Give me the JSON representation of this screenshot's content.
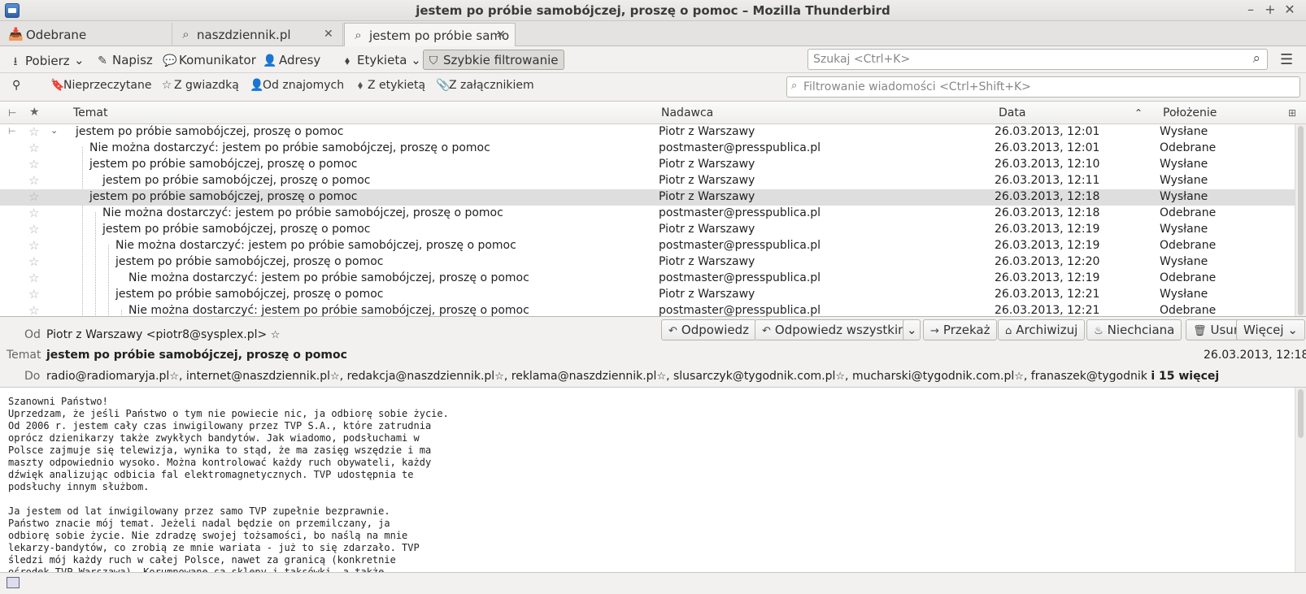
{
  "window": {
    "title": "jestem po próbie samobójczej, proszę o pomoc – Mozilla Thunderbird"
  },
  "tabs": [
    {
      "label": "Odebrane"
    },
    {
      "label": "naszdziennik.pl"
    },
    {
      "label": "jestem po próbie samo"
    }
  ],
  "toolbar": {
    "get_label": "Pobierz",
    "write_label": "Napisz",
    "chat_label": "Komunikator",
    "address_label": "Adresy",
    "tag_label": "Etykieta",
    "quickfilter_label": "Szybkie filtrowanie",
    "search_placeholder": "Szukaj <Ctrl+K>"
  },
  "quickfilter": {
    "unread": "Nieprzeczytane",
    "starred": "Z gwiazdką",
    "contacts": "Od znajomych",
    "tagged": "Z etykietą",
    "attachments": "Z załącznikiem",
    "filter_placeholder": "Filtrowanie wiadomości <Ctrl+Shift+K>"
  },
  "columns": {
    "subject": "Temat",
    "from": "Nadawca",
    "date": "Data",
    "location": "Położenie"
  },
  "messages": [
    {
      "subject": "jestem po próbie samobójczej, proszę o pomoc",
      "from": "Piotr z Warszawy",
      "date": "26.03.2013, 12:01",
      "location": "Wysłane"
    },
    {
      "subject": "Nie można dostarczyć: jestem po próbie samobójczej, proszę o pomoc",
      "from": "postmaster@presspublica.pl",
      "date": "26.03.2013, 12:01",
      "location": "Odebrane"
    },
    {
      "subject": "jestem po próbie samobójczej, proszę o pomoc",
      "from": "Piotr z Warszawy",
      "date": "26.03.2013, 12:10",
      "location": "Wysłane"
    },
    {
      "subject": "jestem po próbie samobójczej, proszę o pomoc",
      "from": "Piotr z Warszawy",
      "date": "26.03.2013, 12:11",
      "location": "Wysłane"
    },
    {
      "subject": "jestem po próbie samobójczej, proszę o pomoc",
      "from": "Piotr z Warszawy",
      "date": "26.03.2013, 12:18",
      "location": "Wysłane"
    },
    {
      "subject": "Nie można dostarczyć: jestem po próbie samobójczej, proszę o pomoc",
      "from": "postmaster@presspublica.pl",
      "date": "26.03.2013, 12:18",
      "location": "Odebrane"
    },
    {
      "subject": "jestem po próbie samobójczej, proszę o pomoc",
      "from": "Piotr z Warszawy",
      "date": "26.03.2013, 12:19",
      "location": "Wysłane"
    },
    {
      "subject": "Nie można dostarczyć: jestem po próbie samobójczej, proszę o pomoc",
      "from": "postmaster@presspublica.pl",
      "date": "26.03.2013, 12:19",
      "location": "Odebrane"
    },
    {
      "subject": "jestem po próbie samobójczej, proszę o pomoc",
      "from": "Piotr z Warszawy",
      "date": "26.03.2013, 12:20",
      "location": "Wysłane"
    },
    {
      "subject": "Nie można dostarczyć: jestem po próbie samobójczej, proszę o pomoc",
      "from": "postmaster@presspublica.pl",
      "date": "26.03.2013, 12:19",
      "location": "Odebrane"
    },
    {
      "subject": "jestem po próbie samobójczej, proszę o pomoc",
      "from": "Piotr z Warszawy",
      "date": "26.03.2013, 12:21",
      "location": "Wysłane"
    },
    {
      "subject": "Nie można dostarczyć: jestem po próbie samobójczej, proszę o pomoc",
      "from": "postmaster@presspublica.pl",
      "date": "26.03.2013, 12:21",
      "location": "Odebrane"
    }
  ],
  "header": {
    "from_label": "Od",
    "from_value": "Piotr z Warszawy <piotr8@sysplex.pl>",
    "subject_label": "Temat",
    "subject_value": "jestem po próbie samobójczej, proszę o pomoc",
    "date_value": "26.03.2013, 12:18",
    "to_label": "Do",
    "recipients": [
      "radio@radiomaryja.pl",
      "internet@naszdziennik.pl",
      "redakcja@naszdziennik.pl",
      "reklama@naszdziennik.pl",
      "slusarczyk@tygodnik.com.pl",
      "mucharski@tygodnik.com.pl",
      "franaszek@tygodnik"
    ],
    "more_recipients": "i 15 więcej",
    "buttons": {
      "reply": "Odpowiedz",
      "reply_all": "Odpowiedz wszystkim",
      "forward": "Przekaż",
      "archive": "Archiwizuj",
      "junk": "Niechciana",
      "delete": "Usuń",
      "more": "Więcej"
    }
  },
  "body": {
    "text": "Szanowni Państwo!\nUprzedzam, że jeśli Państwo o tym nie powiecie nic, ja odbiorę sobie życie.\nOd 2006 r. jestem cały czas inwigilowany przez TVP S.A., które zatrudnia\noprócz dzienikarzy także zwykłych bandytów. Jak wiadomo, podsłuchami w\nPolsce zajmuje się telewizja, wynika to stąd, że ma zasięg wszędzie i ma\nmaszty odpowiednio wysoko. Można kontrolować każdy ruch obywateli, każdy\ndźwięk analizując odbicia fal elektromagnetycznych. TVP udostępnia te\npodsłuchy innym służbom.\n\nJa jestem od lat inwigilowany przez samo TVP zupełnie bezprawnie.\nPaństwo znacie mój temat. Jeżeli nadal będzie on przemilczany, ja\nodbiorę sobie życie. Nie zdradzę swojej tożsamości, bo naślą na mnie\nlekarzy-bandytów, co zrobią ze mnie wariata - już to się zdarzało. TVP\nśledzi mój każdy ruch w całej Polsce, nawet za granicą (konkretnie\nośrodek TVP Warszawa). Korumpowane są sklepy i taksówki, a także"
  }
}
